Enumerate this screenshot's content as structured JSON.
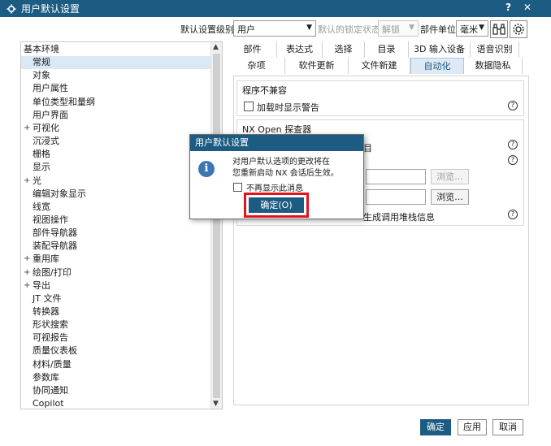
{
  "window": {
    "title": "用户默认设置",
    "help_glyph": "?",
    "close_glyph": "✕"
  },
  "toolbar": {
    "level_label": "默认设置级别",
    "level_value": "用户",
    "lock_label": "默认的锁定状态",
    "lock_value": "解锁",
    "units_label": "部件单位",
    "units_value": "毫米"
  },
  "tree": {
    "items": [
      {
        "label": "基本环境",
        "indent": 0,
        "expander": ""
      },
      {
        "label": "常规",
        "indent": 1,
        "expander": "",
        "selected": true
      },
      {
        "label": "对象",
        "indent": 1,
        "expander": ""
      },
      {
        "label": "用户属性",
        "indent": 1,
        "expander": ""
      },
      {
        "label": "单位类型和量纲",
        "indent": 1,
        "expander": ""
      },
      {
        "label": "用户界面",
        "indent": 1,
        "expander": ""
      },
      {
        "label": "可视化",
        "indent": 1,
        "expander": "+"
      },
      {
        "label": "沉浸式",
        "indent": 1,
        "expander": ""
      },
      {
        "label": "栅格",
        "indent": 1,
        "expander": ""
      },
      {
        "label": "显示",
        "indent": 1,
        "expander": ""
      },
      {
        "label": "光",
        "indent": 1,
        "expander": "+"
      },
      {
        "label": "编辑对象显示",
        "indent": 1,
        "expander": ""
      },
      {
        "label": "线宽",
        "indent": 1,
        "expander": ""
      },
      {
        "label": "视图操作",
        "indent": 1,
        "expander": ""
      },
      {
        "label": "部件导航器",
        "indent": 1,
        "expander": ""
      },
      {
        "label": "装配导航器",
        "indent": 1,
        "expander": ""
      },
      {
        "label": "重用库",
        "indent": 1,
        "expander": "+"
      },
      {
        "label": "绘图/打印",
        "indent": 1,
        "expander": "+"
      },
      {
        "label": "导出",
        "indent": 1,
        "expander": "+"
      },
      {
        "label": "JT 文件",
        "indent": 1,
        "expander": ""
      },
      {
        "label": "转换器",
        "indent": 1,
        "expander": ""
      },
      {
        "label": "形状搜索",
        "indent": 1,
        "expander": ""
      },
      {
        "label": "可视报告",
        "indent": 1,
        "expander": ""
      },
      {
        "label": "质量仪表板",
        "indent": 1,
        "expander": ""
      },
      {
        "label": "材料/质量",
        "indent": 1,
        "expander": ""
      },
      {
        "label": "参数库",
        "indent": 1,
        "expander": ""
      },
      {
        "label": "协同通知",
        "indent": 1,
        "expander": ""
      },
      {
        "label": "Copilot",
        "indent": 1,
        "expander": ""
      }
    ]
  },
  "tabs": {
    "row1": [
      "部件",
      "表达式",
      "选择",
      "目录",
      "3D 输入设备",
      "语音识别"
    ],
    "row2": [
      "杂项",
      "软件更新",
      "文件新建",
      "自动化",
      "数据隐私"
    ],
    "active": "自动化"
  },
  "panel": {
    "group1_title": "程序不兼容",
    "group1_check_label": "加载时显示警告",
    "group2_title": "NX Open 探查器",
    "browse_label": "浏览...",
    "partial_char": "目",
    "partial_stack_label": "生成调用堆栈信息"
  },
  "modal": {
    "title": "用户默认设置",
    "message_line1": "对用户默认选项的更改将在",
    "message_line2": "您重新启动 NX 会话后生效。",
    "checkbox_label": "不再显示此消息",
    "ok_label": "确定(O)"
  },
  "footer": {
    "ok_label": "确定",
    "apply_label": "应用",
    "cancel_label": "取消"
  },
  "colors": {
    "titlebar": "#1c5b82",
    "highlight": "#e0141e",
    "selected_tree": "#dbe8f5"
  }
}
